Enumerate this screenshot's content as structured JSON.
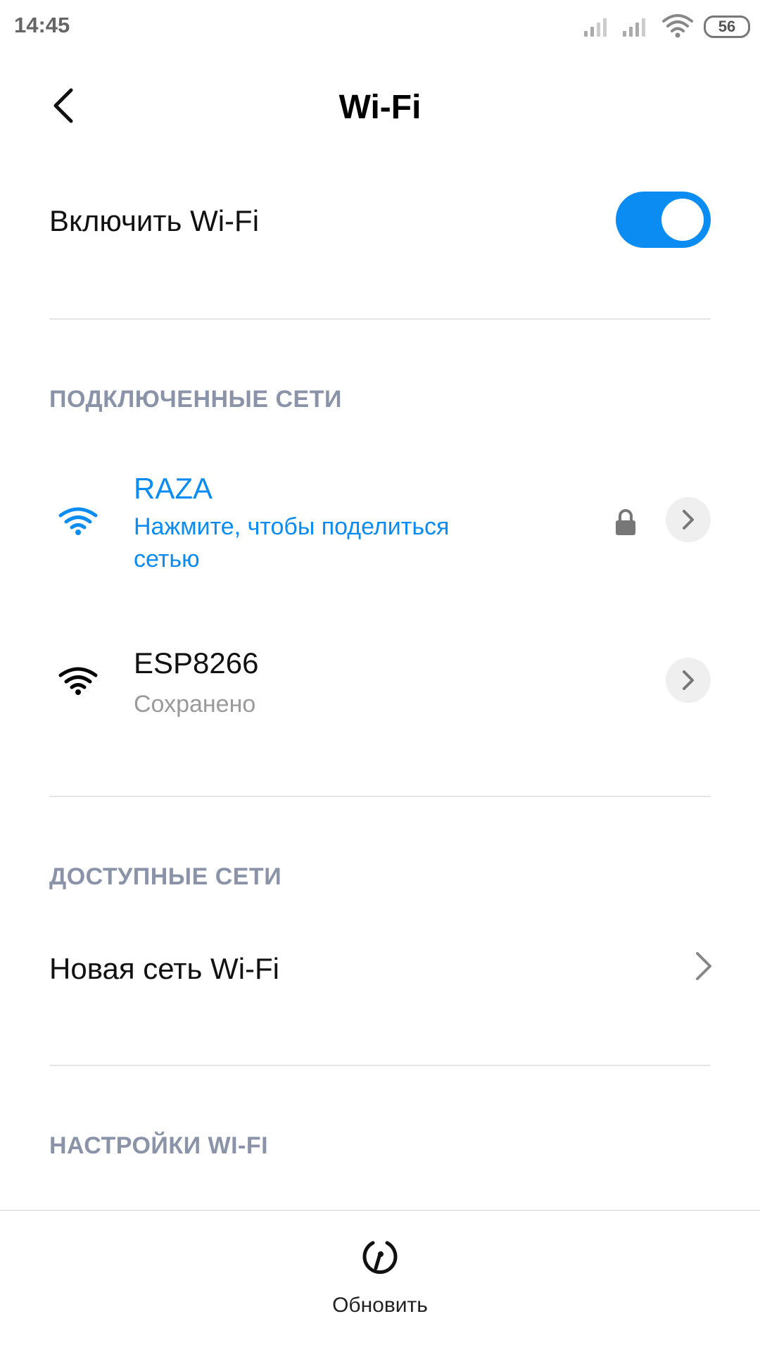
{
  "status_bar": {
    "time": "14:45",
    "battery": "56"
  },
  "header": {
    "title": "Wi-Fi",
    "back_icon": "chevron-left-icon"
  },
  "wifi_toggle": {
    "label": "Включить Wi-Fi",
    "enabled": true,
    "accent_color": "#0a8cf2"
  },
  "sections": {
    "connected": "ПОДКЛЮЧЕННЫЕ СЕТИ",
    "available": "ДОСТУПНЫЕ СЕТИ",
    "settings": "НАСТРОЙКИ WI-FI"
  },
  "connected_networks": [
    {
      "name": "RAZA",
      "status_line1": "Нажмите, чтобы поделиться",
      "status_line2": "сетью",
      "secured": true,
      "active": true,
      "color": "#0a8cf2"
    },
    {
      "name": "ESP8266",
      "status": "Сохранено",
      "secured": false,
      "active": false,
      "color": "#000000"
    }
  ],
  "available": {
    "new_network_label": "Новая сеть Wi-Fi"
  },
  "bottom_bar": {
    "refresh_label": "Обновить",
    "refresh_icon": "refresh-icon"
  }
}
